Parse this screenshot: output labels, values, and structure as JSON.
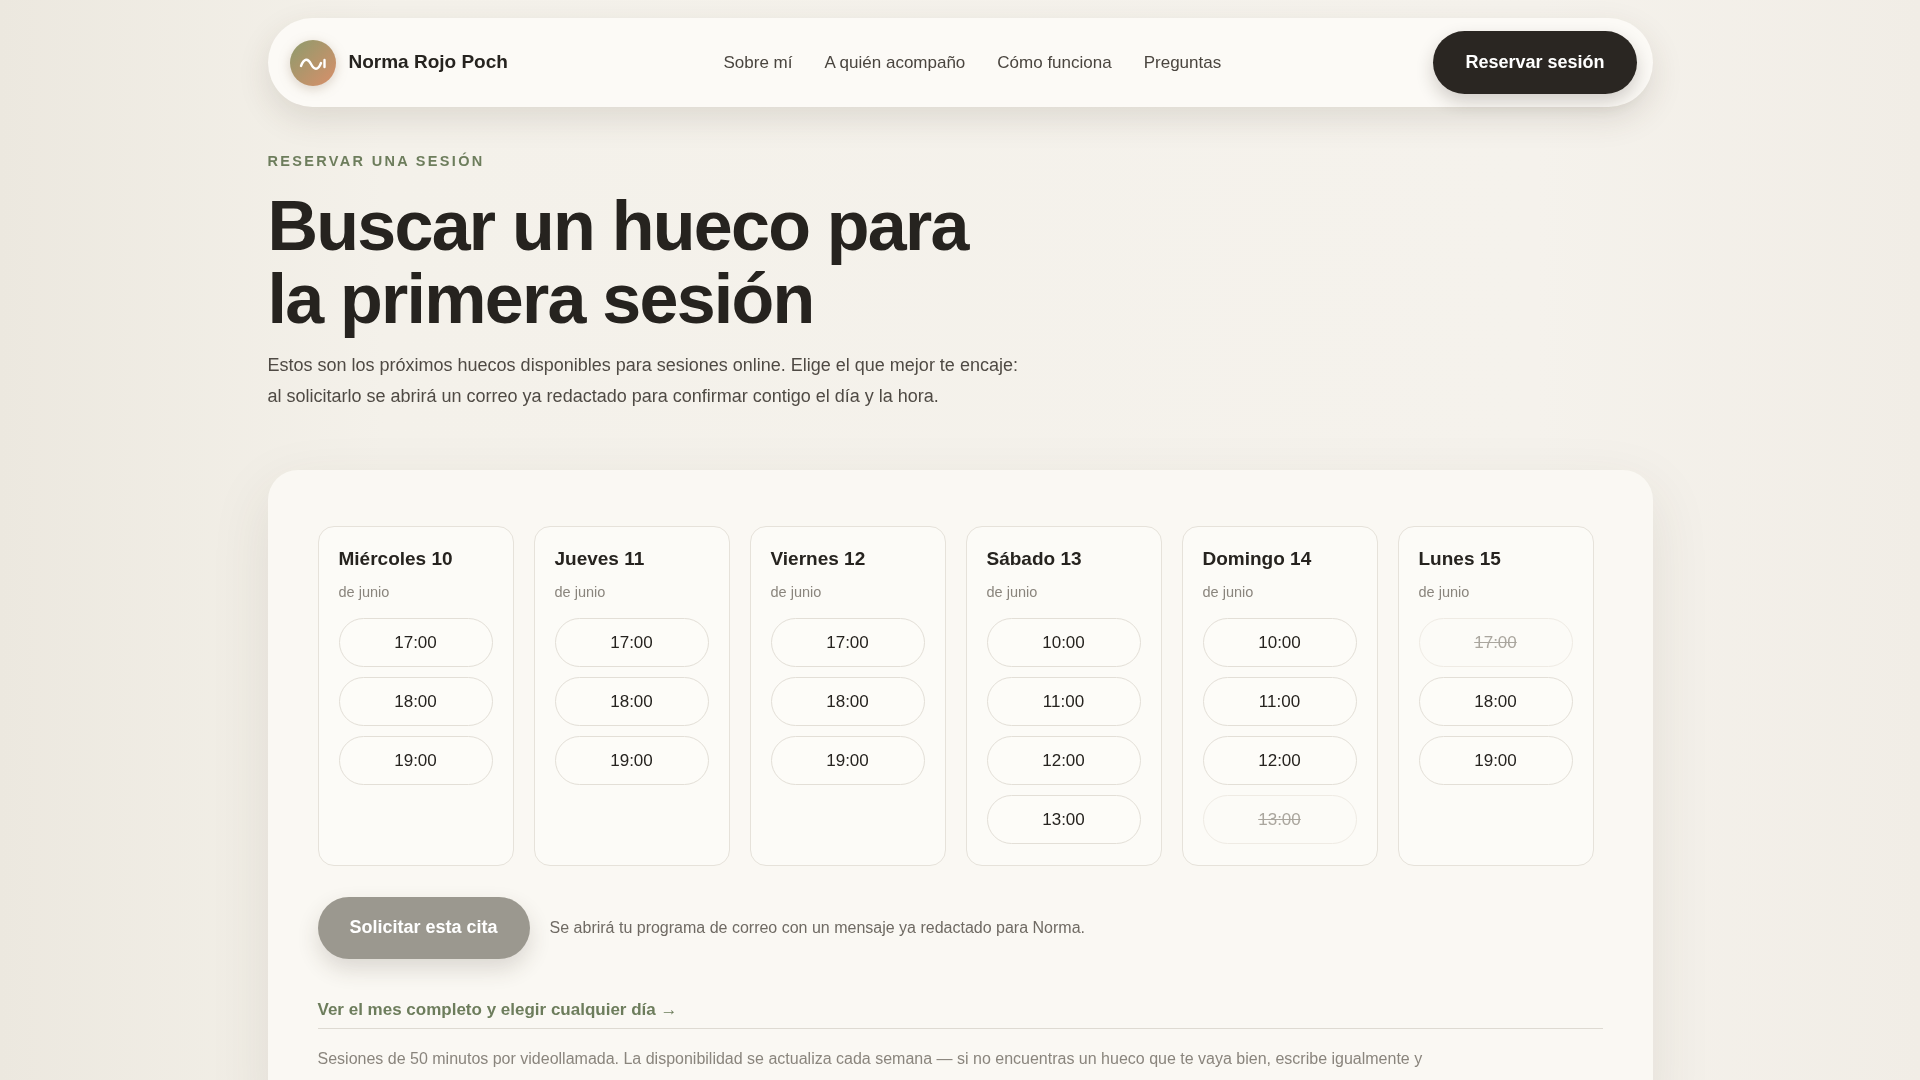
{
  "header": {
    "brand": "Norma Rojo Poch",
    "nav": [
      {
        "label": "Sobre mí"
      },
      {
        "label": "A quién acompaño"
      },
      {
        "label": "Cómo funciona"
      },
      {
        "label": "Preguntas"
      }
    ],
    "cta": "Reservar sesión"
  },
  "intro": {
    "eyebrow": "RESERVAR UNA SESIÓN",
    "title_lines": [
      "Buscar un hueco para",
      "la primera sesión"
    ],
    "description_lines": [
      "Estos son los próximos huecos disponibles para sesiones online. Elige el que mejor te encaje:",
      "al solicitarlo se abrirá un correo ya redactado para confirmar contigo el día y la hora."
    ]
  },
  "booking": {
    "days": [
      {
        "day": "Miércoles 10",
        "month": "de junio",
        "slots": [
          {
            "time": "17:00",
            "disabled": false,
            "selected": false
          },
          {
            "time": "18:00",
            "disabled": false,
            "selected": false
          },
          {
            "time": "19:00",
            "disabled": false,
            "selected": false
          }
        ]
      },
      {
        "day": "Jueves 11",
        "month": "de junio",
        "slots": [
          {
            "time": "17:00",
            "disabled": false,
            "selected": false
          },
          {
            "time": "18:00",
            "disabled": false,
            "selected": false
          },
          {
            "time": "19:00",
            "disabled": false,
            "selected": false
          }
        ]
      },
      {
        "day": "Viernes 12",
        "month": "de junio",
        "slots": [
          {
            "time": "17:00",
            "disabled": false,
            "selected": false
          },
          {
            "time": "18:00",
            "disabled": false,
            "selected": false
          },
          {
            "time": "19:00",
            "disabled": false,
            "selected": false
          }
        ]
      },
      {
        "day": "Sábado 13",
        "month": "de junio",
        "slots": [
          {
            "time": "10:00",
            "disabled": false,
            "selected": false
          },
          {
            "time": "11:00",
            "disabled": false,
            "selected": false
          },
          {
            "time": "12:00",
            "disabled": false,
            "selected": false
          },
          {
            "time": "13:00",
            "disabled": false,
            "selected": false
          }
        ]
      },
      {
        "day": "Domingo 14",
        "month": "de junio",
        "slots": [
          {
            "time": "10:00",
            "disabled": false,
            "selected": false
          },
          {
            "time": "11:00",
            "disabled": false,
            "selected": false
          },
          {
            "time": "12:00",
            "disabled": false,
            "selected": false
          },
          {
            "time": "13:00",
            "disabled": true,
            "selected": false
          }
        ]
      },
      {
        "day": "Lunes 15",
        "month": "de junio",
        "slots": [
          {
            "time": "17:00",
            "disabled": true,
            "selected": false
          },
          {
            "time": "18:00",
            "disabled": false,
            "selected": false
          },
          {
            "time": "19:00",
            "disabled": false,
            "selected": false
          }
        ]
      }
    ],
    "submit": {
      "label": "Solicitar esta cita",
      "disabled": true
    },
    "submit_hint": "Se abrirá tu programa de correo con un mensaje ya redactado para Norma.",
    "month_link": "Ver el mes completo y elegir cualquier día →",
    "footnote": "Sesiones de 50 minutos por videollamada. La disponibilidad se actualiza cada semana — si no encuentras un hueco que te vaya bien, escribe igualmente y"
  }
}
